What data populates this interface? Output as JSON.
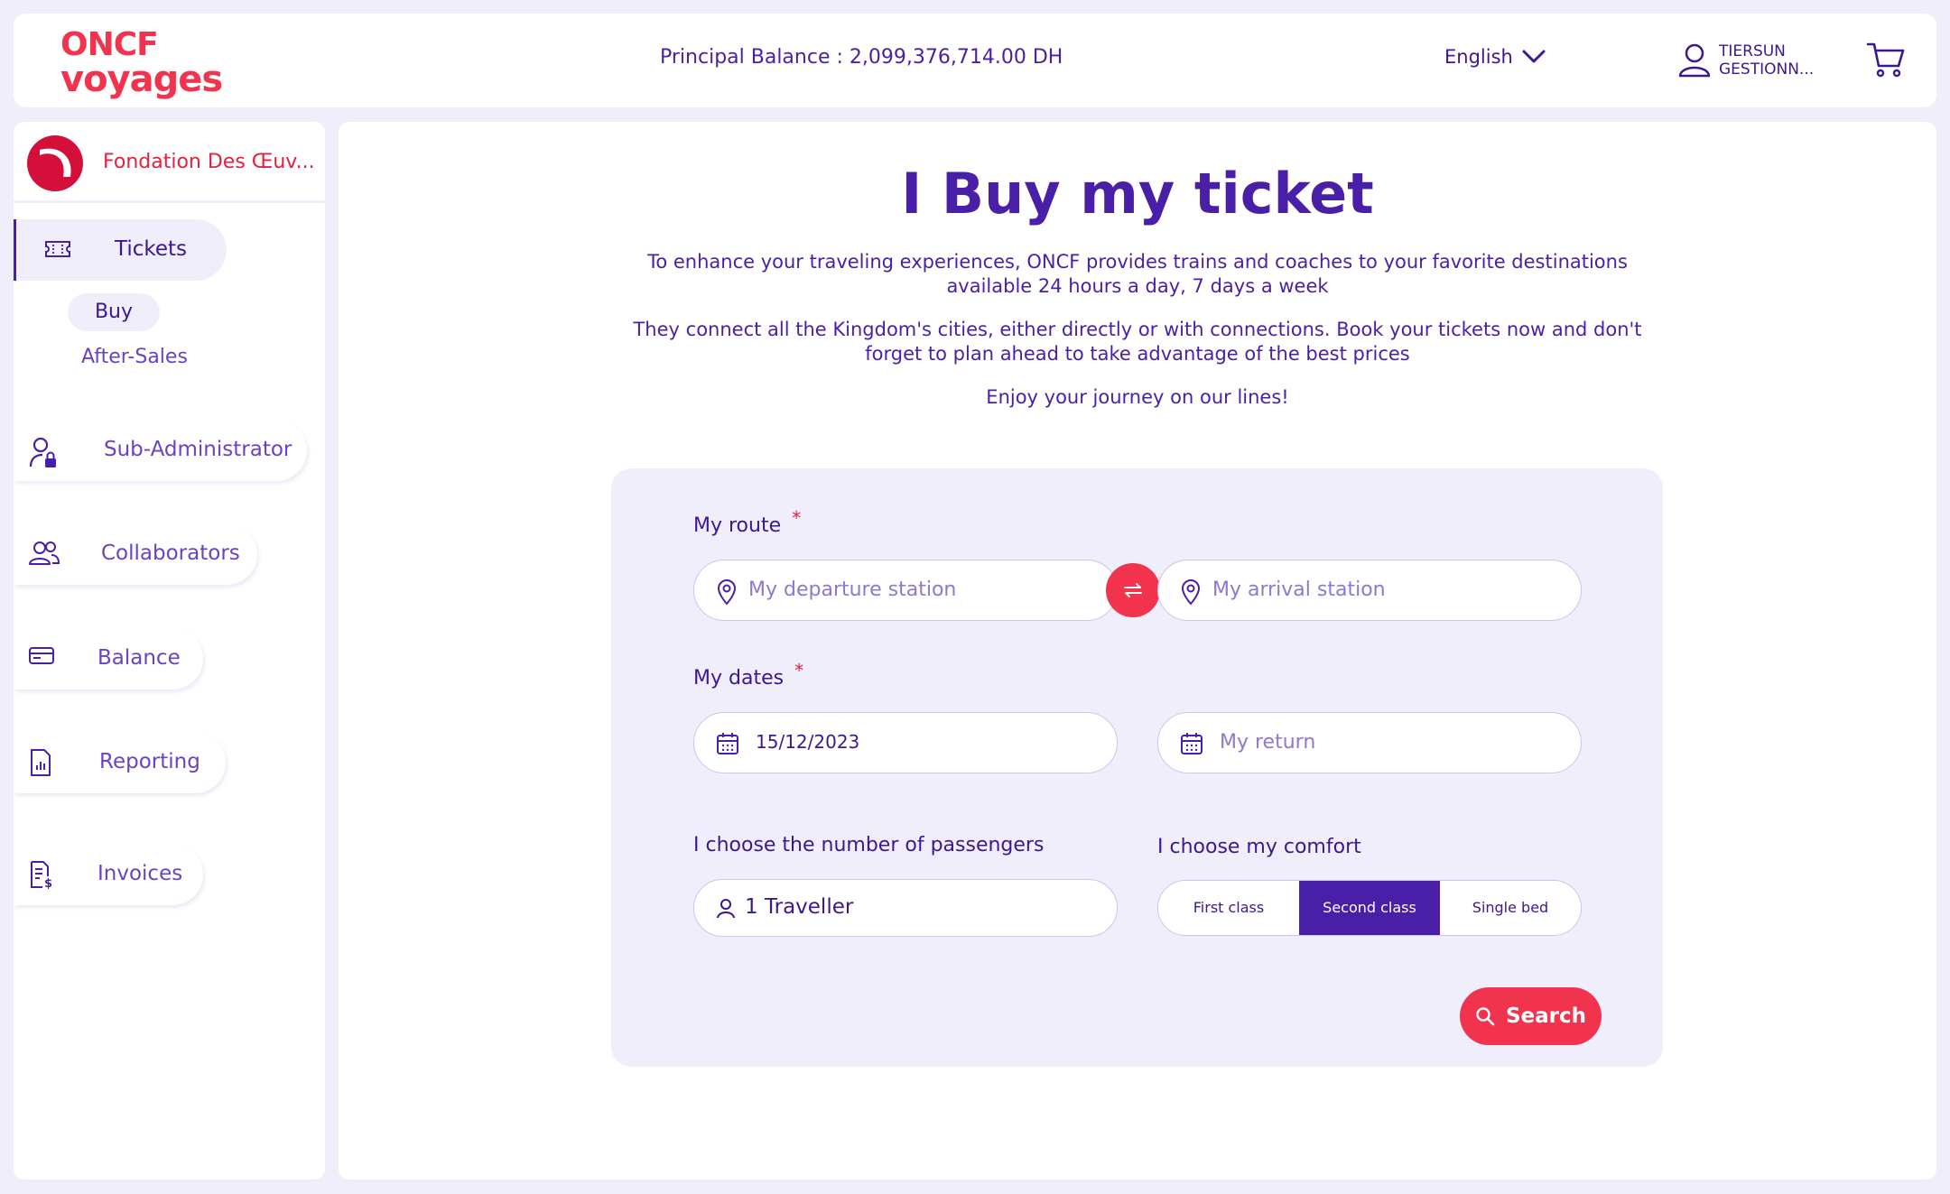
{
  "header": {
    "logo_line1": "ONCF",
    "logo_line2": "voyages",
    "balance_label": "Principal Balance :",
    "balance_value": "2,099,376,714.00 DH",
    "language": "English",
    "user_line1": "TIERSUN",
    "user_line2": "GESTIONN..."
  },
  "sidebar": {
    "org_name": "Fondation Des Œuv...",
    "tickets_label": "Tickets",
    "buy_label": "Buy",
    "after_sales_label": "After-Sales",
    "items": [
      {
        "label": "Sub-Administrator",
        "icon": "user-lock-icon"
      },
      {
        "label": "Collaborators",
        "icon": "users-icon"
      },
      {
        "label": "Balance",
        "icon": "wallet-card-icon"
      },
      {
        "label": "Reporting",
        "icon": "report-chart-icon"
      },
      {
        "label": "Invoices",
        "icon": "invoice-icon"
      }
    ]
  },
  "main": {
    "title": "I Buy my ticket",
    "intro1": "To enhance your traveling experiences, ONCF provides trains and coaches to your favorite destinations available 24 hours a day, 7 days a week",
    "intro2": "They connect all the Kingdom's cities, either directly or with connections. Book your tickets now and don't forget to plan ahead to take advantage of the best prices",
    "intro3": "Enjoy your journey on our lines!"
  },
  "form": {
    "route_label": "My route",
    "required_mark": "*",
    "departure_placeholder": "My departure station",
    "arrival_placeholder": "My arrival station",
    "dates_label": "My dates",
    "departure_date": "15/12/2023",
    "return_placeholder": "My return",
    "passengers_label": "I choose the number of passengers",
    "passengers_value": "1 Traveller",
    "comfort_label": "I choose my comfort",
    "comfort_options": [
      "First class",
      "Second class",
      "Single bed"
    ],
    "comfort_selected": "Second class",
    "search_label": "Search"
  },
  "colors": {
    "brand_red": "#f2334d",
    "brand_purple": "#4a1fa8",
    "panel_bg": "#f1eefb"
  }
}
